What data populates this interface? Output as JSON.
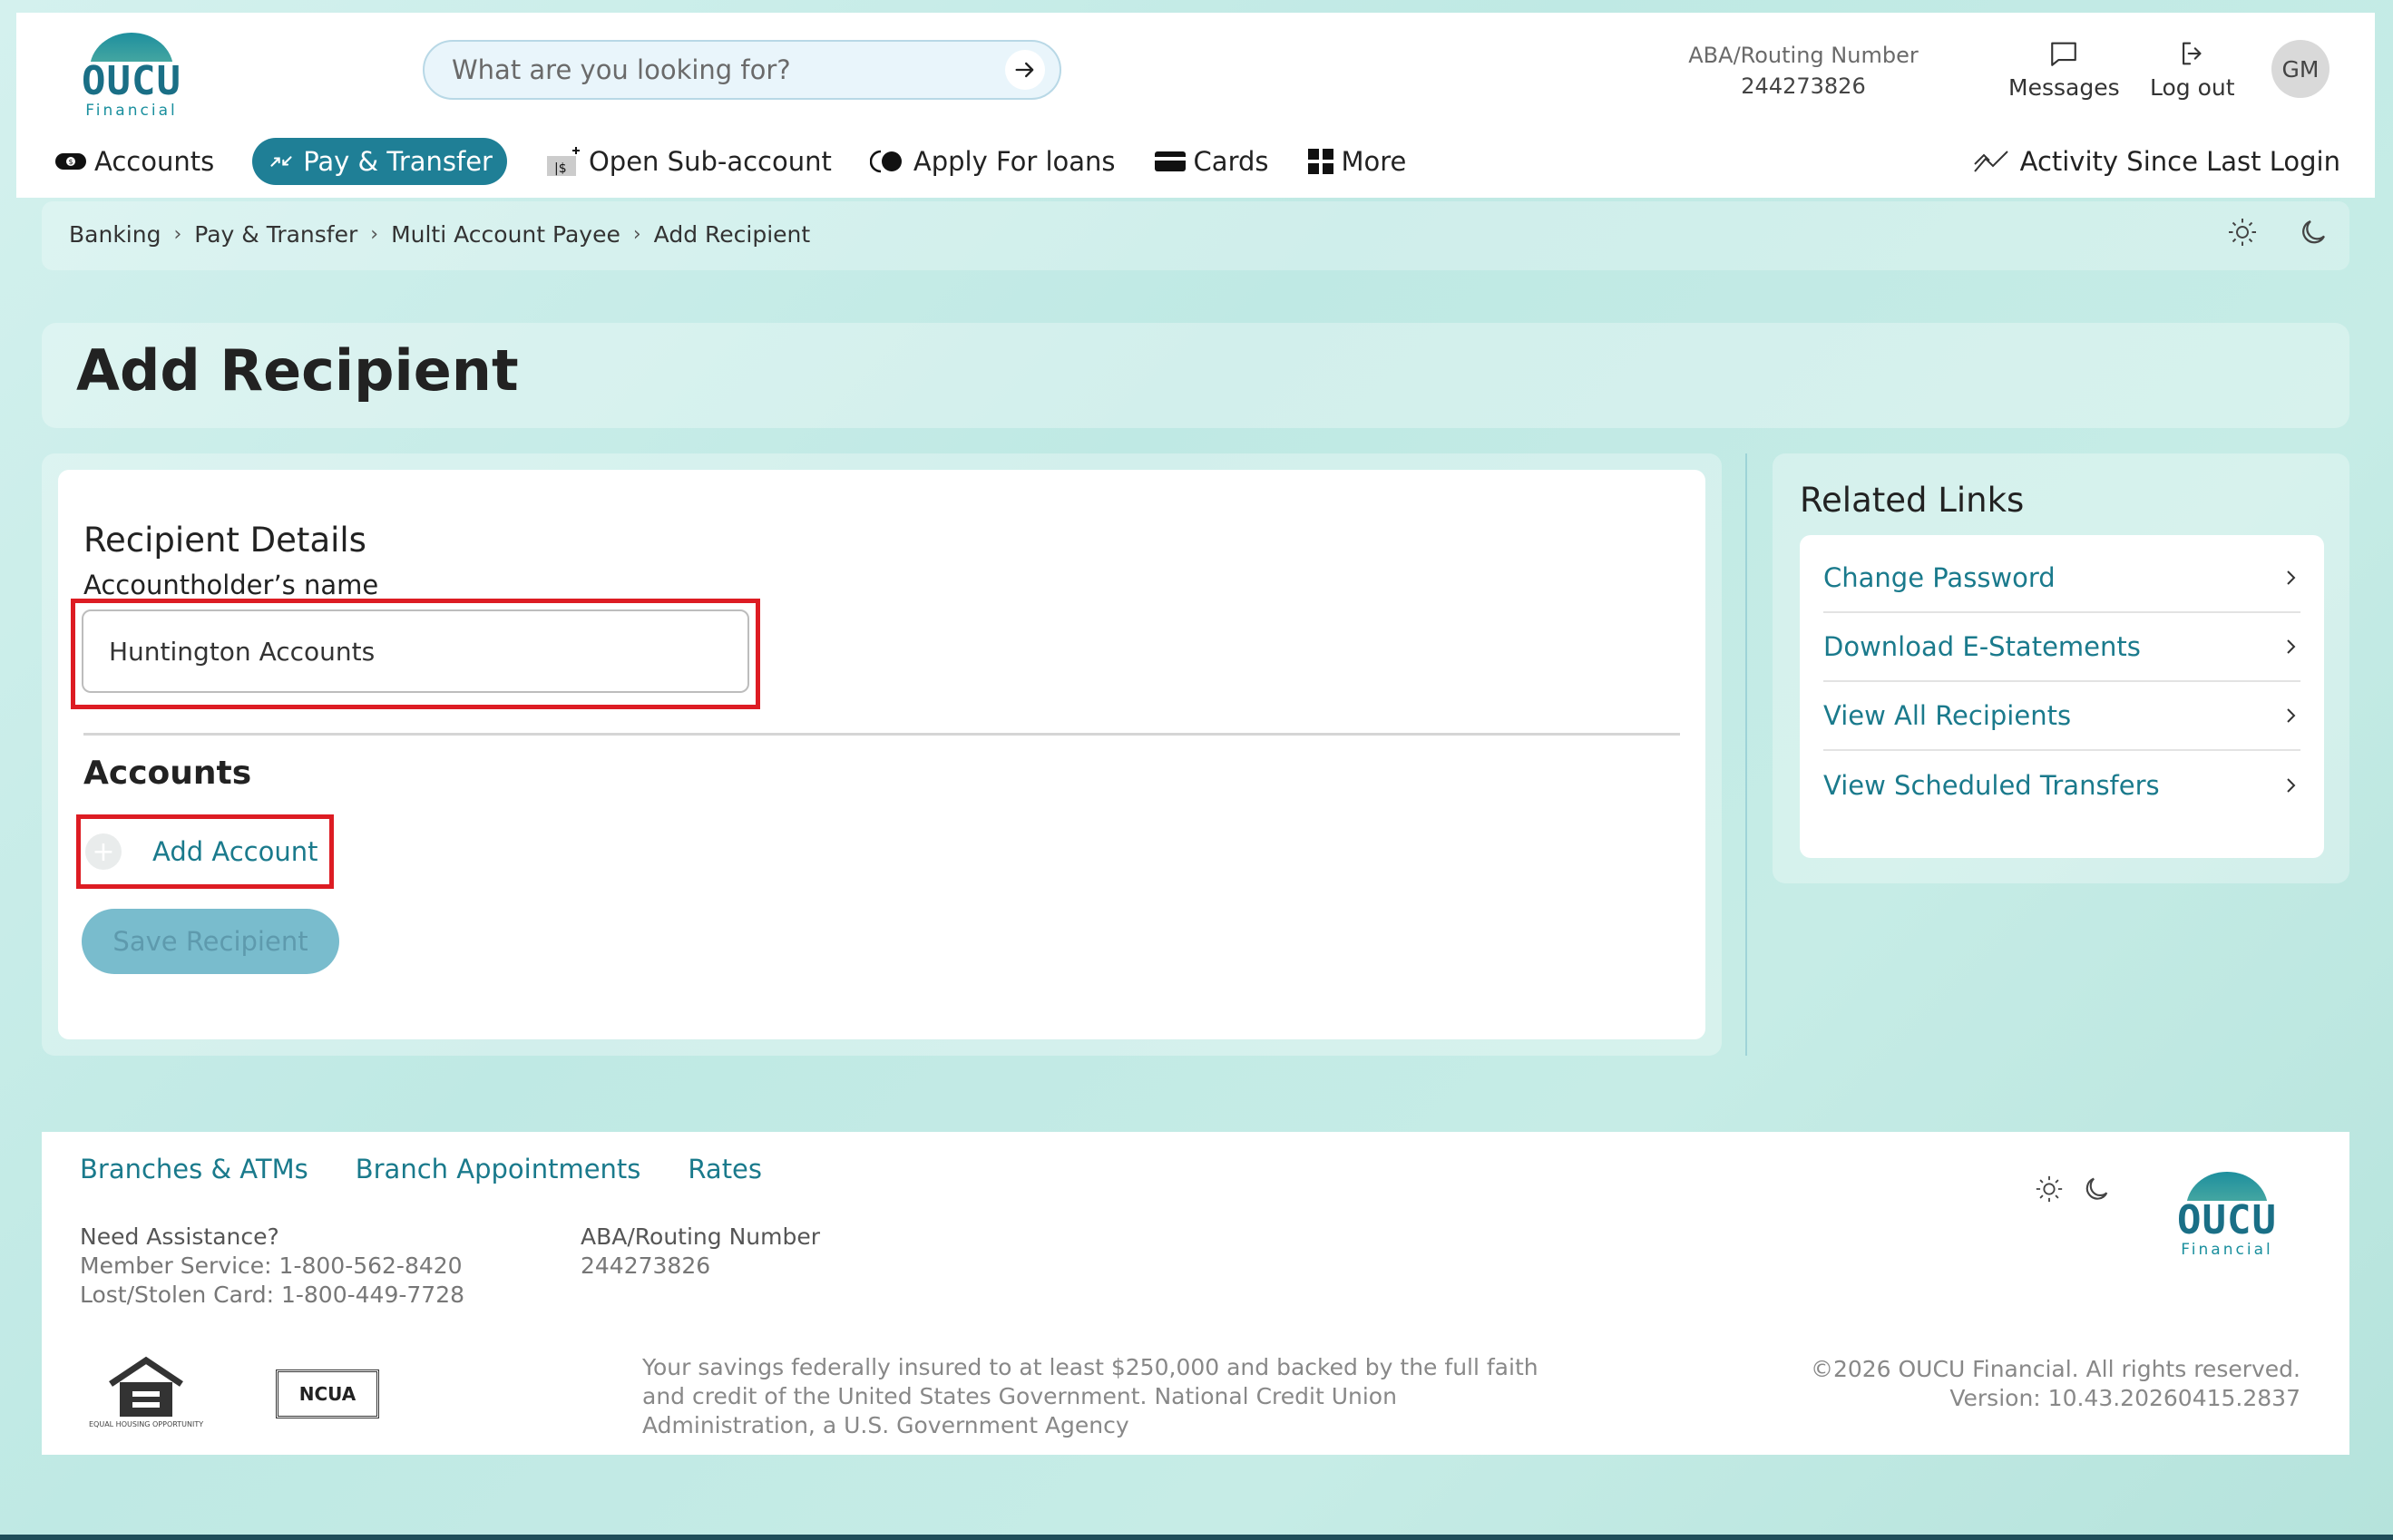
{
  "brand": {
    "logo_word": "OUCU",
    "logo_sub": "Financial",
    "accent": "#1f7f96",
    "link_color": "#1a7a8c",
    "highlight": "#dd1c23"
  },
  "search": {
    "placeholder": "What are you looking for?"
  },
  "routing": {
    "label": "ABA/Routing Number",
    "number": "244273826"
  },
  "header_actions": {
    "messages": "Messages",
    "logout": "Log out",
    "avatar": "GM"
  },
  "nav": {
    "items": [
      {
        "label": "Accounts",
        "icon": "cash-icon"
      },
      {
        "label": "Pay & Transfer",
        "icon": "transfer-icon",
        "active": true
      },
      {
        "label": "Open Sub-account",
        "icon": "sub-account-icon"
      },
      {
        "label": "Apply For loans",
        "icon": "loan-icon"
      },
      {
        "label": "Cards",
        "icon": "card-icon"
      },
      {
        "label": "More",
        "icon": "grid-icon"
      }
    ],
    "activity": "Activity Since Last Login"
  },
  "breadcrumb": [
    "Banking",
    "Pay & Transfer",
    "Multi Account Payee",
    "Add Recipient"
  ],
  "page": {
    "title": "Add Recipient",
    "section_title": "Recipient Details",
    "name_label": "Accountholder’s name",
    "name_value": "Huntington Accounts",
    "accounts_title": "Accounts",
    "add_account": "Add Account",
    "save_button": "Save Recipient"
  },
  "related": {
    "title": "Related Links",
    "links": [
      "Change Password",
      "Download E-Statements",
      "View All Recipients",
      "View Scheduled Transfers"
    ]
  },
  "footer": {
    "links": [
      "Branches & ATMs",
      "Branch Appointments",
      "Rates"
    ],
    "assist_title": "Need Assistance?",
    "member_service": "Member Service: 1-800-562-8420",
    "lost_card": "Lost/Stolen Card: 1-800-449-7728",
    "routing_label": "ABA/Routing Number",
    "routing_number": "244273826",
    "eho_label": "EQUAL HOUSING OPPORTUNITY",
    "ncua": "NCUA",
    "insured_text": "Your savings federally insured to at least $250,000 and backed by the full faith and credit of the United States Government. National Credit Union Administration, a U.S. Government Agency",
    "copyright": "©2026 OUCU Financial. All rights reserved.",
    "version": "Version: 10.43.20260415.2837"
  }
}
